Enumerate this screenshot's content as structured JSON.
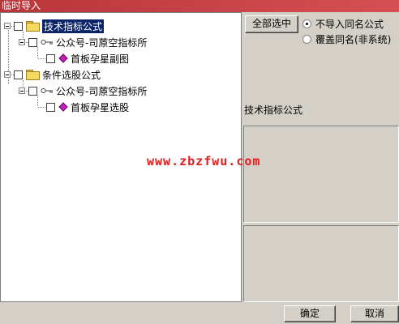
{
  "window": {
    "title": "临时导入"
  },
  "tree": {
    "groups": [
      {
        "label": "技术指标公式",
        "selected": true,
        "child": {
          "label": "公众号-司蒝空指标所",
          "leaf": "首板孕星副图"
        }
      },
      {
        "label": "条件选股公式",
        "selected": false,
        "child": {
          "label": "公众号-司蒝空指标所",
          "leaf": "首板孕星选股"
        }
      }
    ]
  },
  "toolbar": {
    "select_all_label": "全部选中"
  },
  "options": {
    "radio1": {
      "label": "不导入同名公式",
      "checked": true
    },
    "radio2": {
      "label": "覆盖同名(非系统)",
      "checked": false
    }
  },
  "info": {
    "label": "技术指标公式"
  },
  "watermark": {
    "text": "www.zbzfwu.com"
  },
  "footer": {
    "ok_label": "确定",
    "cancel_label": "取消"
  },
  "colors": {
    "title_bar": "#c0393d",
    "selection": "#0a246a",
    "watermark": "#e02020"
  }
}
